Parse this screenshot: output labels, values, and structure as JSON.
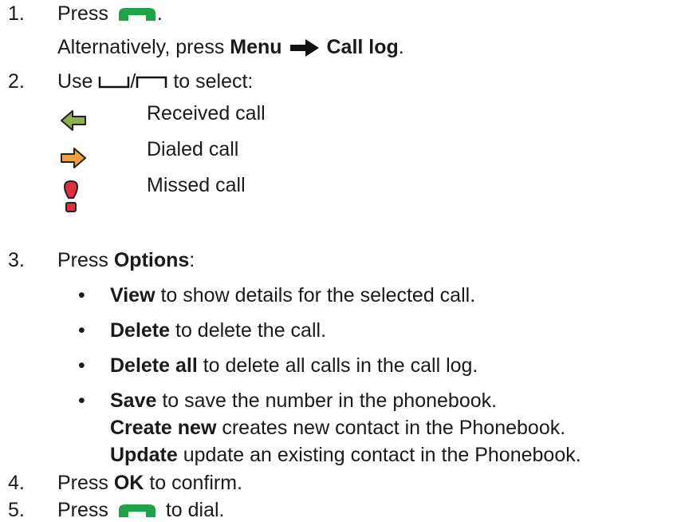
{
  "steps": {
    "s1": {
      "num": "1.",
      "a": "Press",
      "b": ".",
      "alt_prefix": "Alternatively, press",
      "alt_menu": "Menu",
      "alt_target": "Call log",
      "alt_end": "."
    },
    "s2": {
      "num": "2.",
      "a": "Use",
      "sep": "/",
      "b": "to select:"
    },
    "s3": {
      "num": "3.",
      "a": "Press",
      "options": "Options",
      "colon": ":"
    },
    "s4": {
      "num": "4.",
      "a": "Press",
      "ok": "OK",
      "b": "to confirm."
    },
    "s5": {
      "num": "5.",
      "a": "Press",
      "b": "to dial."
    }
  },
  "call_types": [
    {
      "label": "Received call",
      "icon": "received-call-icon",
      "color": "#8db04e"
    },
    {
      "label": "Dialed call",
      "icon": "dialed-call-icon",
      "color": "#f0a040"
    },
    {
      "label": "Missed call",
      "icon": "missed-call-icon",
      "color": "#e03040"
    }
  ],
  "option_items": [
    {
      "bullet": "•",
      "term": "View",
      "desc": "to show details for the selected call."
    },
    {
      "bullet": "•",
      "term": "Delete",
      "desc": "to delete the call."
    },
    {
      "bullet": "•",
      "term": "Delete all",
      "desc": "to delete all calls in the call log."
    },
    {
      "bullet": "•",
      "term": "Save",
      "desc": "to save the number in the phonebook."
    }
  ],
  "save_subitems": [
    {
      "term": "Create new",
      "desc": "creates new contact in the Phonebook."
    },
    {
      "term": "Update",
      "desc": "update an existing contact in the Phonebook."
    }
  ],
  "colors": {
    "call_key": "#1fa24a",
    "arrow": "#111111"
  }
}
